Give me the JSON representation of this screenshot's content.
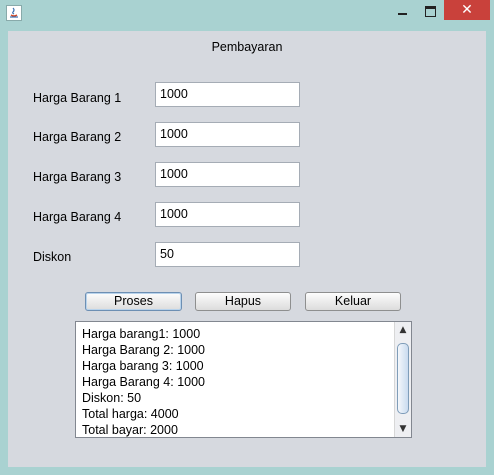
{
  "window": {
    "controls": {
      "minimize_icon": "minimize-icon",
      "maximize_icon": "maximize-icon",
      "close_icon": "close-icon",
      "close_glyph": "✕"
    },
    "close_color": "#c9413b"
  },
  "form": {
    "title": "Pembayaran",
    "fields": [
      {
        "label": "Harga Barang 1",
        "value": "1000"
      },
      {
        "label": "Harga Barang 2",
        "value": "1000"
      },
      {
        "label": "Harga Barang 3",
        "value": "1000"
      },
      {
        "label": "Harga Barang 4",
        "value": "1000"
      },
      {
        "label": "Diskon",
        "value": "50"
      }
    ],
    "buttons": {
      "proses": "Proses",
      "hapus": "Hapus",
      "keluar": "Keluar"
    }
  },
  "output": {
    "lines": [
      "Harga barang1: 1000",
      "Harga Barang 2: 1000",
      "Harga barang 3: 1000",
      "Harga Barang 4: 1000",
      "Diskon: 50",
      "Total harga: 4000",
      "Total bayar: 2000"
    ]
  }
}
